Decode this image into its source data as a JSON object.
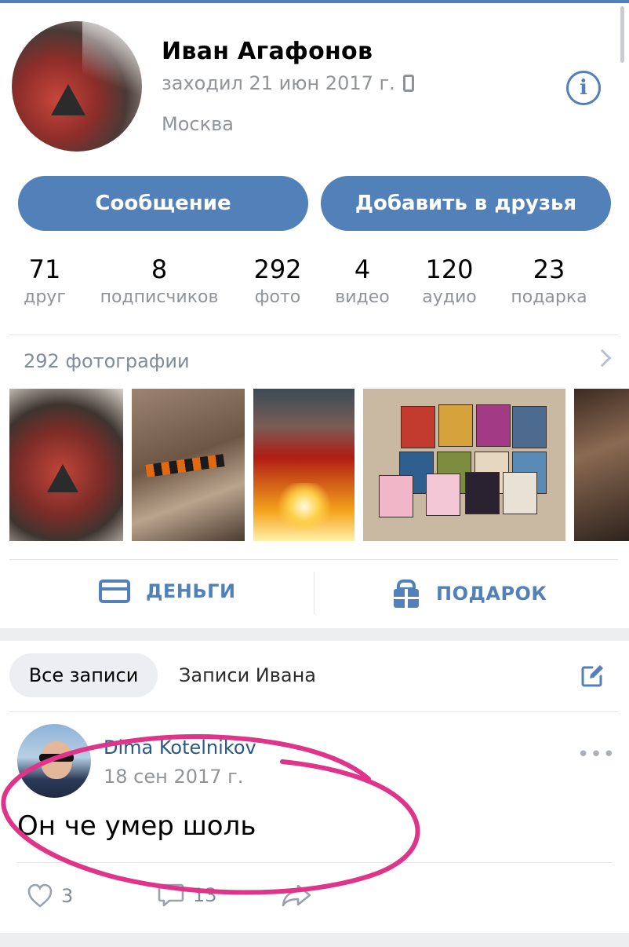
{
  "profile": {
    "name": "Иван Агафонов",
    "last_seen": "заходил 21 июн 2017 г.",
    "city": "Москва"
  },
  "buttons": {
    "message": "Сообщение",
    "add_friend": "Добавить в друзья"
  },
  "counters": [
    {
      "value": "71",
      "label": "друг"
    },
    {
      "value": "8",
      "label": "подписчиков"
    },
    {
      "value": "292",
      "label": "фото"
    },
    {
      "value": "4",
      "label": "видео"
    },
    {
      "value": "120",
      "label": "аудио"
    },
    {
      "value": "23",
      "label": "подарка"
    }
  ],
  "photos": {
    "title": "292 фотографии"
  },
  "actions": {
    "money": "ДЕНЬГИ",
    "gift": "ПОДАРОК"
  },
  "wall": {
    "tabs": [
      "Все записи",
      "Записи Ивана"
    ]
  },
  "post": {
    "author": "Dima Kotelnikov",
    "date": "18 сен 2017 г.",
    "text": "Он че умер шоль",
    "likes": "3",
    "comments": "13"
  },
  "colors": {
    "accent": "#5181b8",
    "secondary_text": "#909499",
    "annotation": "#e0338a"
  }
}
